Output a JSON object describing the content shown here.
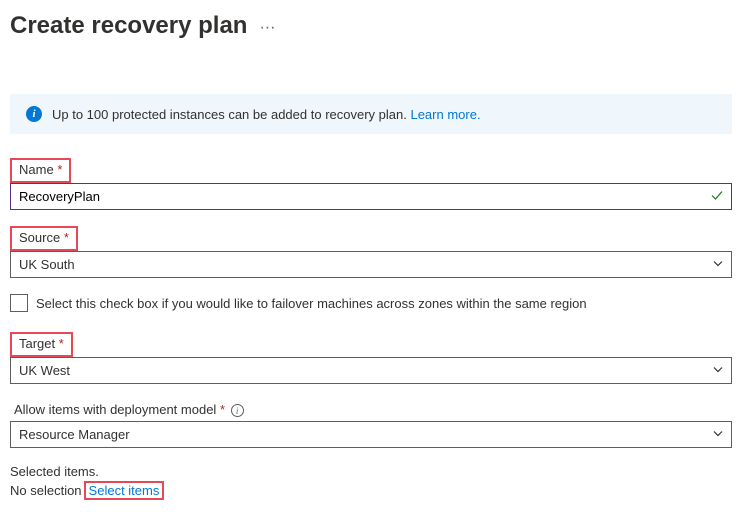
{
  "header": {
    "title": "Create recovery plan"
  },
  "info": {
    "text": "Up to 100 protected instances can be added to recovery plan.",
    "learn_more": "Learn more."
  },
  "fields": {
    "name": {
      "label": "Name",
      "value": "RecoveryPlan"
    },
    "source": {
      "label": "Source",
      "value": "UK South"
    },
    "failover_checkbox": {
      "label": "Select this check box if you would like to failover machines across zones within the same region"
    },
    "target": {
      "label": "Target",
      "value": "UK West"
    },
    "deployment_model": {
      "label": "Allow items with deployment model",
      "value": "Resource Manager"
    }
  },
  "selected": {
    "label": "Selected items.",
    "no_selection": "No selection",
    "link": "Select items"
  }
}
